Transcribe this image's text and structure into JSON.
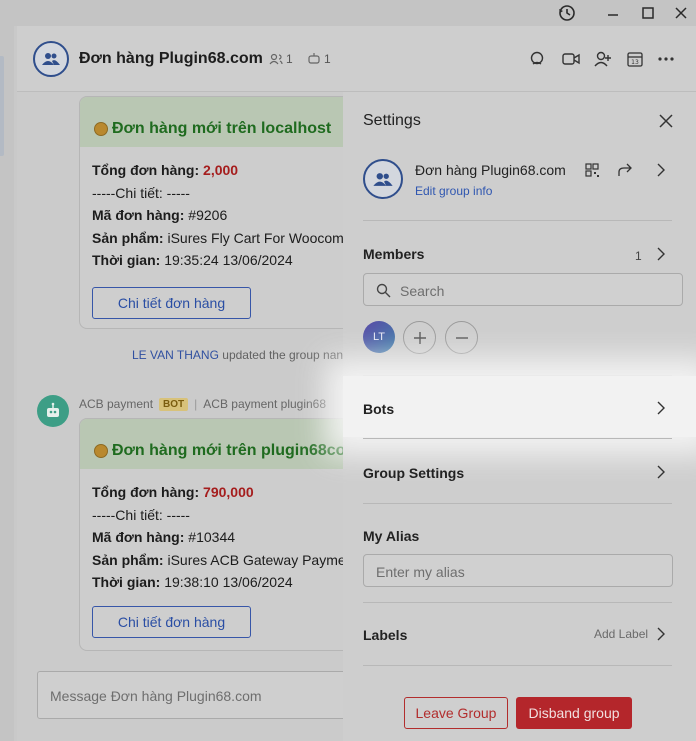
{
  "header": {
    "group_title": "Đơn hàng Plugin68.com",
    "member_count": "1",
    "bot_count": "1"
  },
  "messages": [
    {
      "title": "Đơn hàng mới trên localhost",
      "total_label": "Tổng đơn hàng",
      "total_value": "2,000",
      "detail_line": "-----Chi tiết: -----",
      "order_label": "Mã đơn hàng",
      "order_value": "#9206",
      "product_label": "Sản phẩm",
      "product_value": "iSures Fly Cart For Woocom",
      "time_label": "Thời gian",
      "time_value": "19:35:24 13/06/2024",
      "button": "Chi tiết đơn hàng"
    },
    {
      "title": "Đơn hàng mới trên plugin68co",
      "total_label": "Tổng đơn hàng",
      "total_value": "790,000",
      "detail_line": "-----Chi tiết: -----",
      "order_label": "Mã đơn hàng",
      "order_value": "#10344",
      "product_label": "Sản phẩm",
      "product_value": "iSures ACB Gateway Payme",
      "time_label": "Thời gian",
      "time_value": "19:38:10 13/06/2024",
      "button": "Chi tiết đơn hàng"
    }
  ],
  "system_message": {
    "user": "LE VAN THANG",
    "text": "updated the group nan"
  },
  "bot_sender": {
    "name": "ACB payment",
    "badge": "BOT",
    "subtitle": "ACB payment plugin68"
  },
  "composer": {
    "placeholder": "Message Đơn hàng Plugin68.com"
  },
  "settings": {
    "title": "Settings",
    "group_name": "Đơn hàng Plugin68.com",
    "edit_link": "Edit group info",
    "members_label": "Members",
    "members_count": "1",
    "search_placeholder": "Search",
    "member_initials": "LT",
    "bots_label": "Bots",
    "group_settings_label": "Group Settings",
    "alias_label": "My Alias",
    "alias_placeholder": "Enter my alias",
    "labels_label": "Labels",
    "add_label": "Add Label",
    "leave_button": "Leave Group",
    "disband_button": "Disband group"
  },
  "colors": {
    "accent": "#2f56b0",
    "danger": "#b4262b",
    "success_title": "#1f6b1f",
    "amount": "#a51d1d"
  }
}
